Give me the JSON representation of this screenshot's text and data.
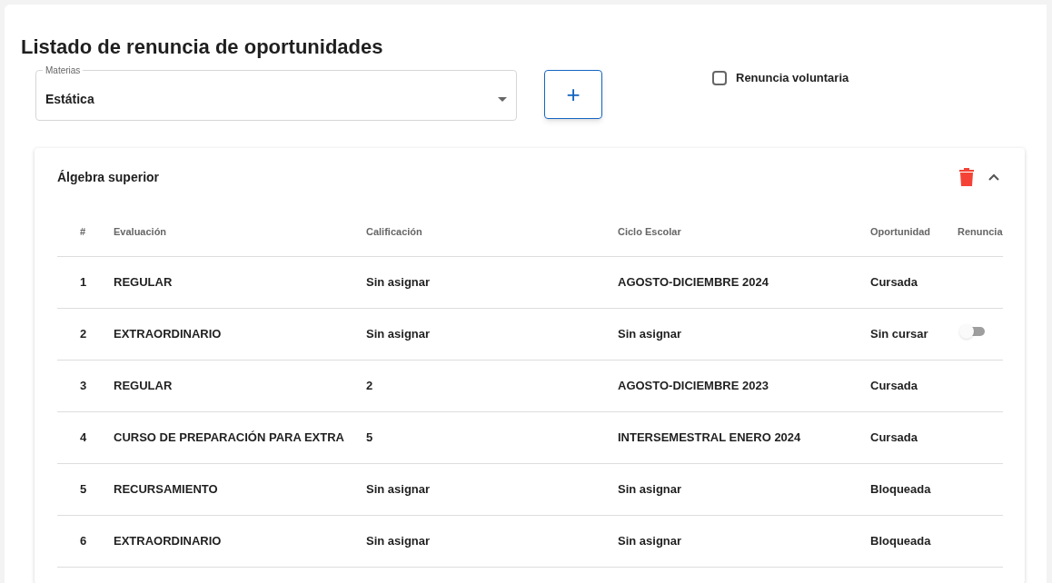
{
  "title": "Listado de renuncia de oportunidades",
  "materia_select": {
    "label": "Materias",
    "value": "Estática"
  },
  "add_button": {
    "label": "+"
  },
  "voluntary_checkbox": {
    "label": "Renuncia voluntaria",
    "checked": false
  },
  "panel": {
    "title": "Álgebra superior",
    "expanded": true,
    "columns": [
      "#",
      "Evaluación",
      "Calificación",
      "Ciclo Escolar",
      "Oportunidad",
      "Renuncia"
    ],
    "rows": [
      {
        "cells": [
          "1",
          "REGULAR",
          "Sin asignar",
          "AGOSTO-DICIEMBRE 2024",
          "Cursada"
        ]
      },
      {
        "cells": [
          "2",
          "EXTRAORDINARIO",
          "Sin asignar",
          "Sin asignar",
          "Sin cursar"
        ],
        "renuncia": {
          "on": false
        }
      },
      {
        "cells": [
          "3",
          "REGULAR",
          "2",
          "AGOSTO-DICIEMBRE 2023",
          "Cursada"
        ]
      },
      {
        "cells": [
          "4",
          "CURSO DE PREPARACIÓN PARA EXTRA",
          "5",
          "INTERSEMESTRAL ENERO 2024",
          "Cursada"
        ]
      },
      {
        "cells": [
          "5",
          "RECURSAMIENTO",
          "Sin asignar",
          "Sin asignar",
          "Bloqueada"
        ]
      },
      {
        "cells": [
          "6",
          "EXTRAORDINARIO",
          "Sin asignar",
          "Sin asignar",
          "Bloqueada"
        ]
      }
    ]
  }
}
